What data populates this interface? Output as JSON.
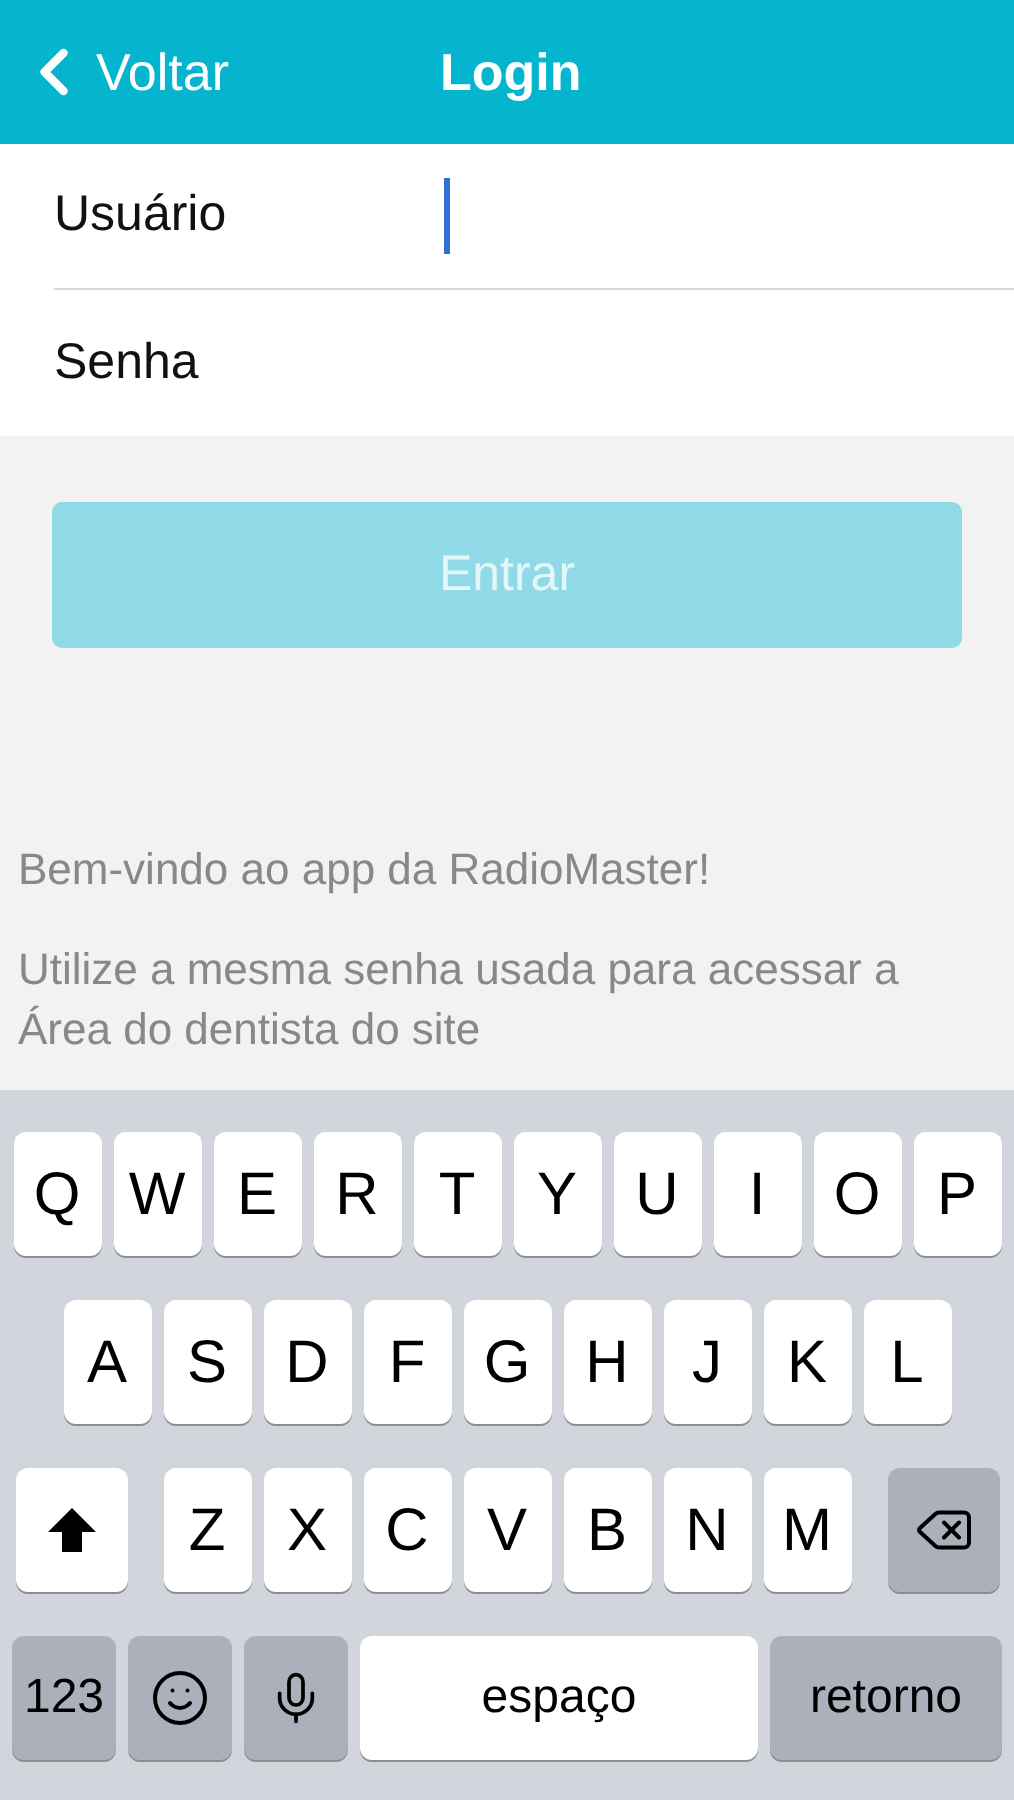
{
  "header": {
    "back": "Voltar",
    "title": "Login"
  },
  "fields": [
    {
      "label": "Usuário",
      "focused": true
    },
    {
      "label": "Senha",
      "focused": false
    }
  ],
  "submit": {
    "label": "Entrar",
    "disabled": true
  },
  "messages": [
    "Bem-vindo ao app da RadioMaster!",
    "Utilize a mesma senha usada para acessar a Área do dentista do site"
  ],
  "keyboard": {
    "rows": [
      {
        "keys": [
          {
            "kind": "letter",
            "label": "Q"
          },
          {
            "kind": "letter",
            "label": "W"
          },
          {
            "kind": "letter",
            "label": "E"
          },
          {
            "kind": "letter",
            "label": "R"
          },
          {
            "kind": "letter",
            "label": "T"
          },
          {
            "kind": "letter",
            "label": "Y"
          },
          {
            "kind": "letter",
            "label": "U"
          },
          {
            "kind": "letter",
            "label": "I"
          },
          {
            "kind": "letter",
            "label": "O"
          },
          {
            "kind": "letter",
            "label": "P"
          }
        ]
      },
      {
        "keys": [
          {
            "kind": "letter",
            "label": "A"
          },
          {
            "kind": "letter",
            "label": "S"
          },
          {
            "kind": "letter",
            "label": "D"
          },
          {
            "kind": "letter",
            "label": "F"
          },
          {
            "kind": "letter",
            "label": "G"
          },
          {
            "kind": "letter",
            "label": "H"
          },
          {
            "kind": "letter",
            "label": "J"
          },
          {
            "kind": "letter",
            "label": "K"
          },
          {
            "kind": "letter",
            "label": "L"
          }
        ]
      },
      {
        "keys": [
          {
            "kind": "shift"
          },
          {
            "kind": "letter",
            "label": "Z"
          },
          {
            "kind": "letter",
            "label": "X"
          },
          {
            "kind": "letter",
            "label": "C"
          },
          {
            "kind": "letter",
            "label": "V"
          },
          {
            "kind": "letter",
            "label": "B"
          },
          {
            "kind": "letter",
            "label": "N"
          },
          {
            "kind": "letter",
            "label": "M"
          },
          {
            "kind": "delete"
          }
        ]
      },
      {
        "keys": [
          {
            "kind": "mode",
            "label": "123"
          },
          {
            "kind": "emoji"
          },
          {
            "kind": "mic"
          },
          {
            "kind": "space",
            "label": "espaço"
          },
          {
            "kind": "return",
            "label": "retorno"
          }
        ]
      }
    ]
  }
}
